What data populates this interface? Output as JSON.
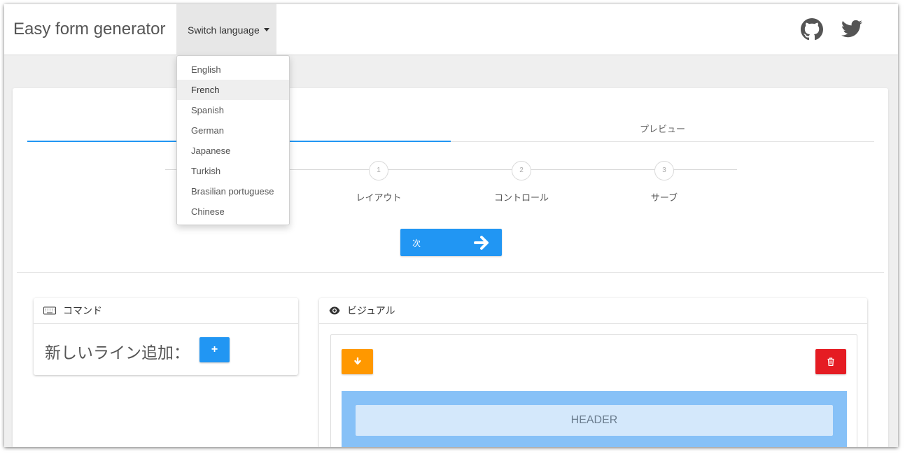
{
  "navbar": {
    "brand": "Easy form generator",
    "switch_language": "Switch language",
    "icons": [
      "github-icon",
      "twitter-icon"
    ]
  },
  "language_menu": {
    "selected": "French",
    "items": [
      "English",
      "French",
      "Spanish",
      "German",
      "Japanese",
      "Turkish",
      "Brasilian portuguese",
      "Chinese"
    ]
  },
  "tabs": {
    "preview": "プレビュー"
  },
  "stepper": {
    "steps": [
      {
        "number": "1",
        "label": "レイアウト"
      },
      {
        "number": "2",
        "label": "コントロール"
      },
      {
        "number": "3",
        "label": "サーブ"
      }
    ]
  },
  "next_button": {
    "label": "次"
  },
  "command_panel": {
    "title": "コマンド",
    "add_line_label": "新しいライン追加：",
    "add_button": "+"
  },
  "visual_panel": {
    "title": "ビジュアル",
    "header_text": "HEADER"
  },
  "colors": {
    "primary": "#2196f3",
    "warning": "#ff9800",
    "danger": "#e51c23",
    "header_zone": "#87c1f7"
  }
}
